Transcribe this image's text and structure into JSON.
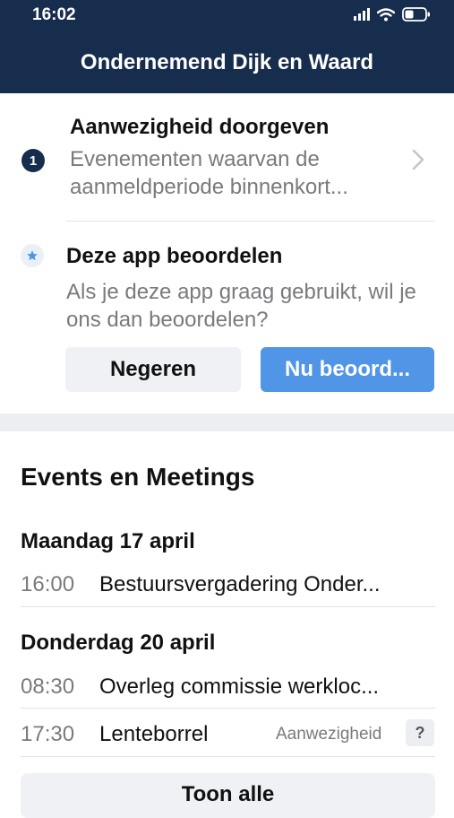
{
  "status_bar": {
    "time": "16:02"
  },
  "header": {
    "title": "Ondernemend Dijk en Waard"
  },
  "attendance": {
    "badge_count": "1",
    "title": "Aanwezigheid doorgeven",
    "subtitle": "Evenementen waarvan de aanmeldperiode binnenkort..."
  },
  "rate_app": {
    "title": "Deze app beoordelen",
    "subtitle": "Als je deze app graag gebruikt, wil je ons dan beoordelen?",
    "ignore_label": "Negeren",
    "rate_label": "Nu beoord..."
  },
  "events": {
    "section_title": "Events en Meetings",
    "days": [
      {
        "label": "Maandag 17 april",
        "items": [
          {
            "time": "16:00",
            "name": "Bestuursvergadering Onder..."
          }
        ]
      },
      {
        "label": "Donderdag 20 april",
        "items": [
          {
            "time": "08:30",
            "name": "Overleg commissie werkloc..."
          },
          {
            "time": "17:30",
            "name": "Lenteborrel",
            "attendance_label": "Aanwezigheid",
            "attendance_value": "?"
          }
        ]
      }
    ],
    "show_all_label": "Toon alle"
  },
  "colors": {
    "header_bg": "#172d4e",
    "accent_blue": "#5195e6",
    "muted_text": "#7a7a7e",
    "button_gray": "#eff1f4"
  }
}
